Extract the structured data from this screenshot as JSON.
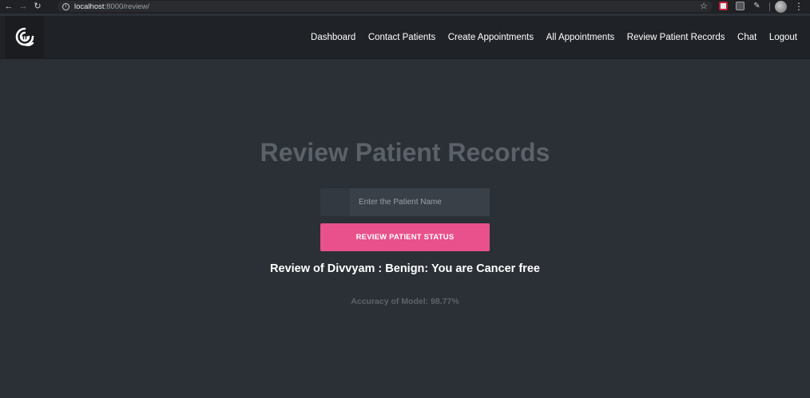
{
  "browser": {
    "url_host": "localhost",
    "url_path": ":8000/review/"
  },
  "navbar": {
    "links": [
      "Dashboard",
      "Contact Patients",
      "Create Appointments",
      "All Appointments",
      "Review Patient Records",
      "Chat",
      "Logout"
    ]
  },
  "main": {
    "title": "Review Patient Records",
    "input_placeholder": "Enter the Patient Name",
    "button_label": "REVIEW PATIENT STATUS",
    "result": "Review of Divvyam : Benign: You are Cancer free",
    "accuracy": "Accuracy of Model: 98.77%"
  },
  "colors": {
    "background": "#2b3036",
    "navbar": "#1f2226",
    "accent_button": "#e8518c",
    "title": "#5b6168"
  },
  "icons": [
    "back-icon",
    "forward-icon",
    "reload-icon",
    "info-icon",
    "star-icon",
    "logo-icon",
    "menu-icon"
  ]
}
